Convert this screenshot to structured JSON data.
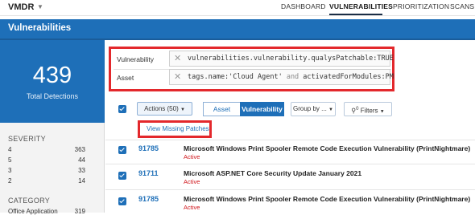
{
  "app": {
    "name": "VMDR"
  },
  "nav": [
    "DASHBOARD",
    "VULNERABILITIES",
    "PRIORITIZATION",
    "SCANS"
  ],
  "nav_active": "VULNERABILITIES",
  "page_title": "Vulnerabilities",
  "summary": {
    "count": "439",
    "label": "Total Detections"
  },
  "severity": {
    "heading": "SEVERITY",
    "rows": [
      {
        "level": "4",
        "count": "363"
      },
      {
        "level": "5",
        "count": "44"
      },
      {
        "level": "3",
        "count": "33"
      },
      {
        "level": "2",
        "count": "14"
      }
    ]
  },
  "category": {
    "heading": "CATEGORY",
    "rows": [
      {
        "label": "Office Application",
        "count": "319"
      }
    ]
  },
  "filters": {
    "vulnerability": {
      "label": "Vulnerability",
      "query": "vulnerabilities.vulnerability.qualysPatchable:TRUE"
    },
    "asset": {
      "label": "Asset",
      "query_parts": [
        "tags.name:'Cloud Agent'",
        " and ",
        "activatedForModules:PM"
      ]
    }
  },
  "toolbar": {
    "actions_label": "Actions (50)",
    "asset_label": "Asset",
    "vulnerability_label": "Vulnerability",
    "groupby_label": "Group by ...",
    "filters_count": "0",
    "filters_label": "Filters",
    "menu_item": "View Missing Patches"
  },
  "rows": [
    {
      "qid": "91785",
      "title": "Microsoft Windows Print Spooler Remote Code Execution Vulnerability (PrintNightmare)",
      "status": "Active"
    },
    {
      "qid": "91711",
      "title": "Microsoft ASP.NET Core Security Update January 2021",
      "status": "Active"
    },
    {
      "qid": "91785",
      "title": "Microsoft Windows Print Spooler Remote Code Execution Vulnerability (PrintNightmare)",
      "status": "Active"
    }
  ],
  "colors": {
    "accent": "#1e6fb8",
    "highlight": "#e3282c",
    "status_active": "#d0161b"
  }
}
